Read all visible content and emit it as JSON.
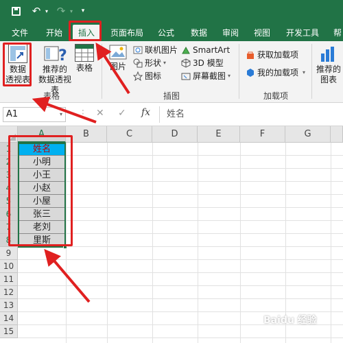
{
  "qat": {
    "save_icon": "save-icon",
    "undo_icon": "undo-icon",
    "redo_icon": "redo-icon"
  },
  "tabs": [
    "文件",
    "开始",
    "插入",
    "页面布局",
    "公式",
    "数据",
    "审阅",
    "视图",
    "开发工具",
    "帮"
  ],
  "active_tab": "插入",
  "ribbon": {
    "pivot_table": [
      "数据",
      "透视表"
    ],
    "recommended_pivot": [
      "推荐的",
      "数据透视表"
    ],
    "table": "表格",
    "tables_group": "表格",
    "picture": "图片",
    "online_picture": "联机图片",
    "shapes": "形状",
    "icons": "图标",
    "smartart": "SmartArt",
    "model_3d": "3D 模型",
    "screenshot": "屏幕截图",
    "illustrations_group": "插图",
    "get_addins": "获取加载项",
    "my_addins": "我的加载项",
    "addins_group": "加载项",
    "recommended_charts": [
      "推荐的",
      "图表"
    ]
  },
  "formula_bar": {
    "name_box": "A1",
    "formula": "姓名",
    "fx": "fx"
  },
  "columns": [
    "A",
    "B",
    "C",
    "D",
    "E",
    "F",
    "G"
  ],
  "rows": [
    "1",
    "2",
    "3",
    "4",
    "5",
    "6",
    "7",
    "8",
    "9",
    "10",
    "11",
    "12",
    "13",
    "14",
    "15"
  ],
  "cells_A": [
    "姓名",
    "小明",
    "小王",
    "小赵",
    "小屋",
    "张三",
    "老刘",
    "里斯"
  ],
  "watermark": "Baidu 经验",
  "colors": {
    "excel_green": "#217346",
    "header_fill": "#00b0f0",
    "header_text": "#c00000",
    "annotation": "#e02020"
  }
}
